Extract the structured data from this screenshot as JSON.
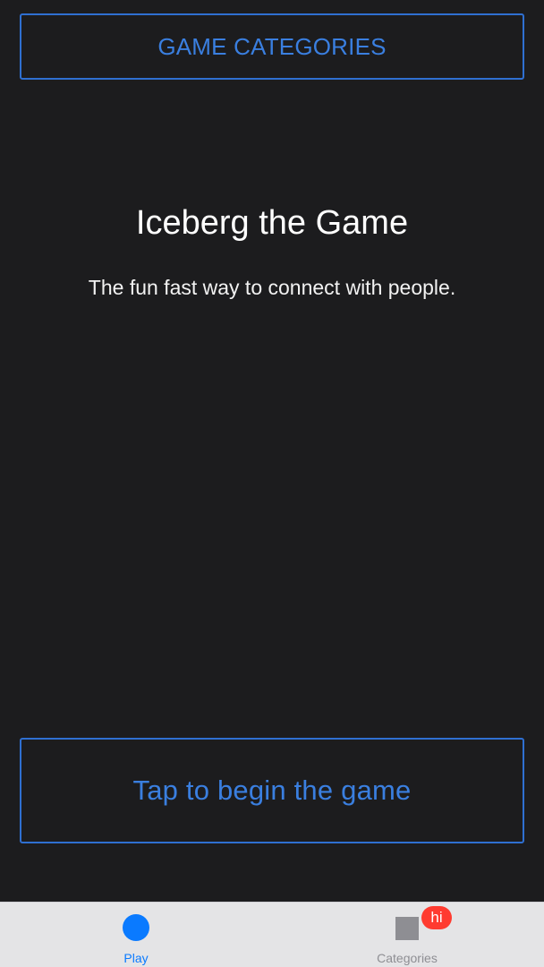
{
  "header": {
    "categories_button_label": "GAME CATEGORIES"
  },
  "main": {
    "title": "Iceberg the Game",
    "subtitle": "The fun fast way to connect with people.",
    "begin_button_label": "Tap to begin the game"
  },
  "tabbar": {
    "tabs": [
      {
        "label": "Play",
        "icon": "play-circle-icon",
        "selected": true
      },
      {
        "label": "Categories",
        "icon": "categories-square-icon",
        "badge": "hi",
        "selected": false
      }
    ]
  },
  "colors": {
    "background": "#1c1c1e",
    "accent": "#3a7fe0",
    "tab_active": "#0a7aff",
    "tab_inactive": "#8e8e93",
    "badge": "#ff3b30",
    "tabbar_background": "#e4e4e6"
  }
}
